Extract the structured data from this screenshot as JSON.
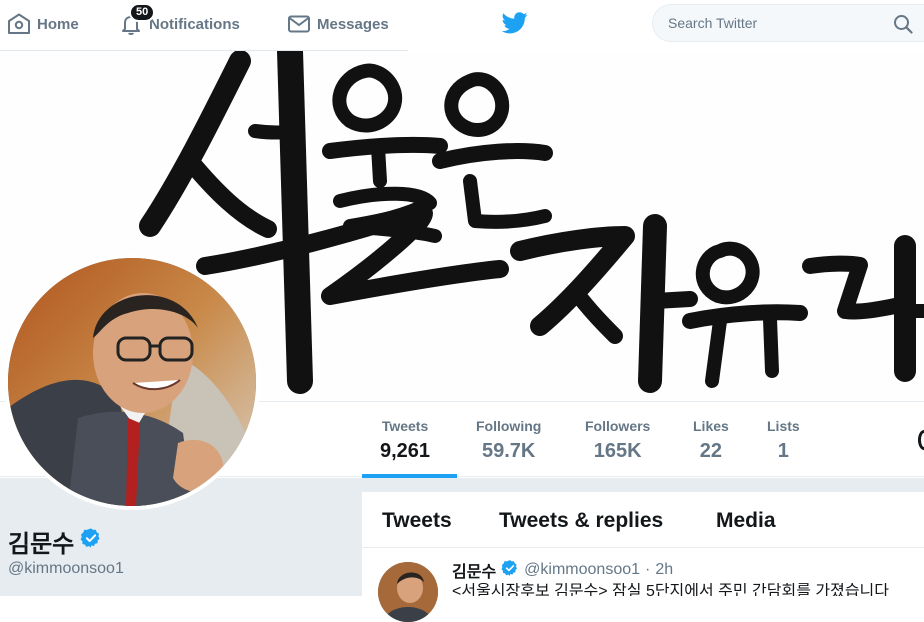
{
  "nav": {
    "home_label": "Home",
    "notifications_label": "Notifications",
    "notifications_count": "50",
    "messages_label": "Messages"
  },
  "search": {
    "placeholder": "Search Twitter"
  },
  "banner": {
    "calligraphy_text": "서울은 자유다!"
  },
  "stats": [
    {
      "label": "Tweets",
      "value": "9,261"
    },
    {
      "label": "Following",
      "value": "59.7K"
    },
    {
      "label": "Followers",
      "value": "165K"
    },
    {
      "label": "Likes",
      "value": "22"
    },
    {
      "label": "Lists",
      "value": "1"
    }
  ],
  "profile": {
    "name": "김문수",
    "handle": "@kimmoonsoo1",
    "verified": true
  },
  "tabs": [
    "Tweets",
    "Tweets & replies",
    "Media"
  ],
  "tweet": {
    "name": "김문수",
    "handle": "@kimmoonsoo1",
    "dot": "·",
    "time": "2h",
    "text": "<서울시장후보 김문수> 잠실 5단지에서 주민 간담회를 가졌습니다"
  },
  "colors": {
    "accent": "#1da1f2",
    "muted": "#657786",
    "text": "#14171a",
    "background_gray": "#e6ecf0"
  },
  "icons": [
    "home-icon",
    "bell-icon",
    "envelope-icon",
    "twitter-bird-icon",
    "search-icon",
    "verified-icon"
  ]
}
